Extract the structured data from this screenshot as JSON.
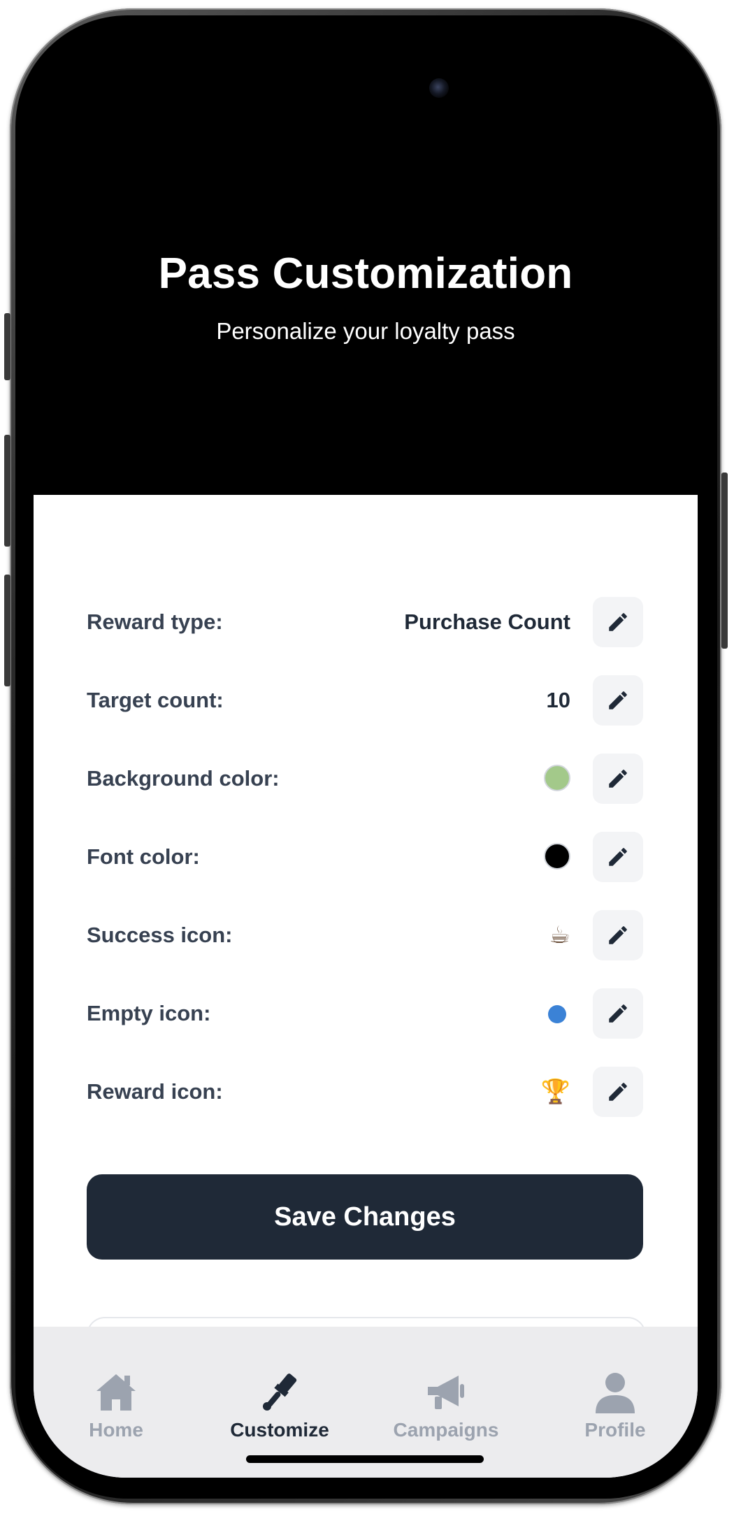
{
  "header": {
    "title": "Pass Customization",
    "subtitle": "Personalize your loyalty pass"
  },
  "settings": [
    {
      "label": "Reward type:",
      "kind": "text",
      "value": "Purchase Count",
      "edit_icon": "pencil-icon"
    },
    {
      "label": "Target count:",
      "kind": "text",
      "value": "10",
      "edit_icon": "pencil-icon"
    },
    {
      "label": "Background color:",
      "kind": "color",
      "color": "#a3c98a",
      "edit_icon": "pencil-icon"
    },
    {
      "label": "Font color:",
      "kind": "color",
      "color": "#000000",
      "edit_icon": "pencil-icon"
    },
    {
      "label": "Success icon:",
      "kind": "icon",
      "icon": "coffee-cup-icon",
      "glyph": "☕",
      "edit_icon": "pencil-icon"
    },
    {
      "label": "Empty icon:",
      "kind": "icon",
      "icon": "blue-circle-icon",
      "color": "#3b82d6",
      "edit_icon": "pencil-icon"
    },
    {
      "label": "Reward icon:",
      "kind": "icon",
      "icon": "trophy-icon",
      "glyph": "🏆",
      "edit_icon": "pencil-icon"
    }
  ],
  "save_button": {
    "label": "Save Changes"
  },
  "tabs": [
    {
      "label": "Home",
      "icon": "house-icon",
      "active": false
    },
    {
      "label": "Customize",
      "icon": "paintbrush-icon",
      "active": true
    },
    {
      "label": "Campaigns",
      "icon": "megaphone-icon",
      "active": false
    },
    {
      "label": "Profile",
      "icon": "person-icon",
      "active": false
    }
  ],
  "colors": {
    "header_bg": "#000000",
    "card_bg": "#ffffff",
    "primary": "#1f2937",
    "label": "#374151",
    "tab_inactive": "#9ca3af",
    "tab_active": "#1f2937",
    "edit_button_bg": "#f3f4f6"
  }
}
